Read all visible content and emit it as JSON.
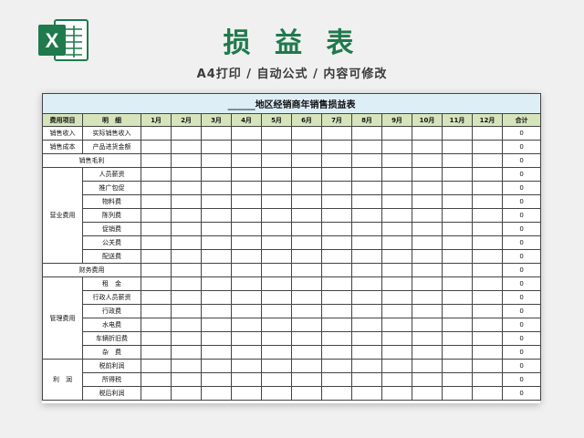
{
  "header": {
    "title": "损 益 表",
    "subtitle": "A4打印 / 自动公式 / 内容可修改",
    "logo_icon": "excel-logo-icon",
    "logo_color": "#1f7a4c"
  },
  "sheet": {
    "title": "______地区经销商年销售损益表",
    "columns": [
      "费用项目",
      "明　细",
      "1月",
      "2月",
      "3月",
      "4月",
      "5月",
      "6月",
      "7月",
      "8月",
      "9月",
      "10月",
      "11月",
      "12月",
      "合计"
    ],
    "rows": [
      {
        "cat": "销售收入",
        "item": "实际销售收入",
        "total": "0"
      },
      {
        "cat": "销售成本",
        "item": "产品进货金额",
        "total": "0"
      },
      {
        "cat": "销售毛利",
        "item": "",
        "total": "0",
        "merged": true
      },
      {
        "cat": "营业费用",
        "item": "人员薪资",
        "total": "0",
        "span": 7
      },
      {
        "item": "推广包促",
        "total": "0"
      },
      {
        "item": "物料费",
        "total": "0"
      },
      {
        "item": "陈列费",
        "total": "0"
      },
      {
        "item": "促销费",
        "total": "0"
      },
      {
        "item": "公关费",
        "total": "0"
      },
      {
        "item": "配送费",
        "total": "0"
      },
      {
        "cat": "财务费用",
        "item": "",
        "total": "0",
        "merged": true
      },
      {
        "cat": "管理费用",
        "item": "租　金",
        "total": "0",
        "span": 6
      },
      {
        "item": "行政人员薪资",
        "total": "0"
      },
      {
        "item": "行政费",
        "total": "0"
      },
      {
        "item": "水电费",
        "total": "0"
      },
      {
        "item": "车辆折旧费",
        "total": "0"
      },
      {
        "item": "杂　费",
        "total": "0"
      },
      {
        "cat": "利　润",
        "item": "税前利润",
        "total": "0",
        "span": 3
      },
      {
        "item": "所得税",
        "total": "0"
      },
      {
        "item": "税后利润",
        "total": "0"
      }
    ]
  }
}
